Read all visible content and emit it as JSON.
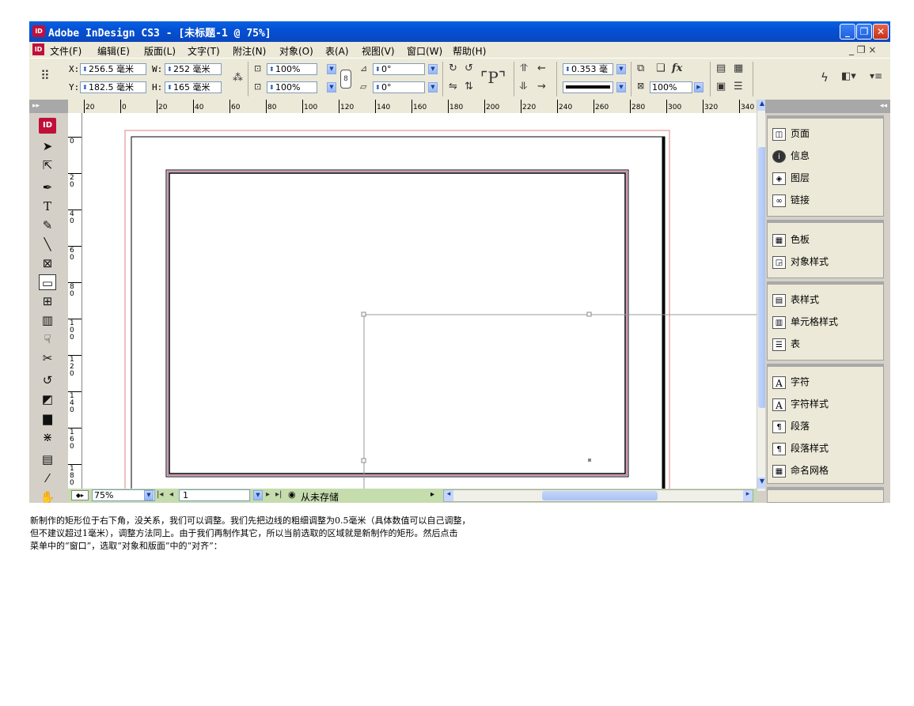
{
  "window": {
    "logo": "ID",
    "title": "Adobe InDesign CS3 - [未标题-1 @ 75%]",
    "minimize": "_",
    "restore": "❐",
    "close": "✕"
  },
  "menu": {
    "logo": "ID",
    "items": [
      "文件(F)",
      "编辑(E)",
      "版面(L)",
      "文字(T)",
      "附注(N)",
      "对象(O)",
      "表(A)",
      "视图(V)",
      "窗口(W)",
      "帮助(H)"
    ],
    "doc_controls": "_ ❐ ×"
  },
  "control": {
    "x_label": "X:",
    "x_value": "256.5 毫米",
    "y_label": "Y:",
    "y_value": "182.5 毫米",
    "w_label": "W:",
    "w_value": "252 毫米",
    "h_label": "H:",
    "h_value": "165 毫米",
    "scale_x": "100%",
    "scale_y": "100%",
    "rotate": "0°",
    "shear": "0°",
    "stroke_weight": "0.353 毫",
    "opacity": "100%",
    "fx": "fx"
  },
  "ruler": {
    "h_ticks": [
      "20",
      "0",
      "20",
      "40",
      "60",
      "80",
      "100",
      "120",
      "140",
      "160",
      "180",
      "200",
      "220",
      "240",
      "260",
      "280",
      "300",
      "320",
      "340"
    ],
    "v_ticks": [
      "0",
      "2\n0",
      "4\n0",
      "6\n0",
      "8\n0",
      "1\n0\n0",
      "1\n2\n0",
      "1\n4\n0",
      "1\n6\n0",
      "1\n8\n0"
    ]
  },
  "status": {
    "zoom": "75%",
    "page": "1",
    "save_state": "从未存储"
  },
  "panels": {
    "groups": [
      [
        {
          "icon": "page-icon",
          "label": "页面"
        },
        {
          "icon": "info-icon",
          "label": "信息"
        },
        {
          "icon": "layers-icon",
          "label": "图层"
        },
        {
          "icon": "links-icon",
          "label": "链接"
        }
      ],
      [
        {
          "icon": "swatches-icon",
          "label": "色板"
        },
        {
          "icon": "object-styles-icon",
          "label": "对象样式"
        }
      ],
      [
        {
          "icon": "table-styles-icon",
          "label": "表样式"
        },
        {
          "icon": "cell-styles-icon",
          "label": "单元格样式"
        },
        {
          "icon": "table-icon",
          "label": "表"
        }
      ],
      [
        {
          "icon": "character-icon",
          "label": "字符"
        },
        {
          "icon": "character-styles-icon",
          "label": "字符样式"
        },
        {
          "icon": "paragraph-icon",
          "label": "段落"
        },
        {
          "icon": "paragraph-styles-icon",
          "label": "段落样式"
        },
        {
          "icon": "named-grid-icon",
          "label": "命名网格"
        }
      ]
    ]
  },
  "caption": {
    "lines": [
      "新制作的矩形位于右下角，没关系，我们可以调整。我们先把边线的粗细调整为0.5毫米（具体数值可以自己调整，",
      "但不建议超过1毫米），调整方法同上。由于我们再制作其它，所以当前选取的区域就是新制作的矩形。然后点击",
      "菜单中的“窗口”，选取“对象和版面”中的“对齐”："
    ]
  }
}
